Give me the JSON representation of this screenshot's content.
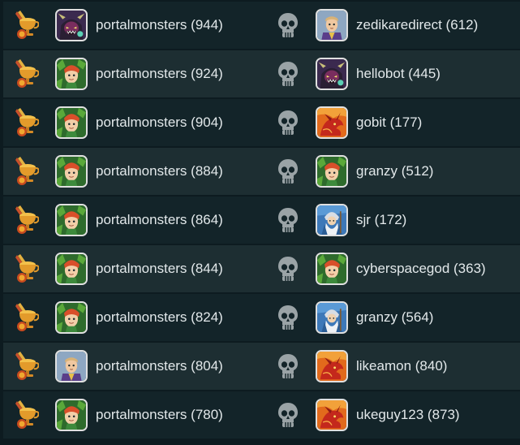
{
  "colors": {
    "page_bg": "#0d1b20",
    "row_odd": "#132429",
    "row_even": "#1d2e32",
    "text": "#e2e8ea",
    "trophy": "#e8a53c",
    "skull": "#9aa3a6"
  },
  "icons": {
    "winner": "trophy-medal-icon",
    "loser": "skull-icon"
  },
  "matches": [
    {
      "winner": {
        "name": "portalmonsters (944)",
        "avatar": "dark-monster"
      },
      "loser": {
        "name": "zedikaredirect (612)",
        "avatar": "purple-hero"
      }
    },
    {
      "winner": {
        "name": "portalmonsters (924)",
        "avatar": "green-elf"
      },
      "loser": {
        "name": "hellobot (445)",
        "avatar": "dark-monster"
      }
    },
    {
      "winner": {
        "name": "portalmonsters (904)",
        "avatar": "green-elf"
      },
      "loser": {
        "name": "gobit (177)",
        "avatar": "red-dragon"
      }
    },
    {
      "winner": {
        "name": "portalmonsters (884)",
        "avatar": "green-elf"
      },
      "loser": {
        "name": "granzy (512)",
        "avatar": "green-elf"
      }
    },
    {
      "winner": {
        "name": "portalmonsters (864)",
        "avatar": "green-elf"
      },
      "loser": {
        "name": "sjr (172)",
        "avatar": "blue-wizard"
      }
    },
    {
      "winner": {
        "name": "portalmonsters (844)",
        "avatar": "green-elf"
      },
      "loser": {
        "name": "cyberspacegod (363)",
        "avatar": "green-elf"
      }
    },
    {
      "winner": {
        "name": "portalmonsters (824)",
        "avatar": "green-elf"
      },
      "loser": {
        "name": "granzy (564)",
        "avatar": "blue-wizard"
      }
    },
    {
      "winner": {
        "name": "portalmonsters (804)",
        "avatar": "purple-hero"
      },
      "loser": {
        "name": "likeamon (840)",
        "avatar": "red-dragon"
      }
    },
    {
      "winner": {
        "name": "portalmonsters (780)",
        "avatar": "green-elf"
      },
      "loser": {
        "name": "ukeguy123 (873)",
        "avatar": "red-dragon"
      }
    }
  ]
}
